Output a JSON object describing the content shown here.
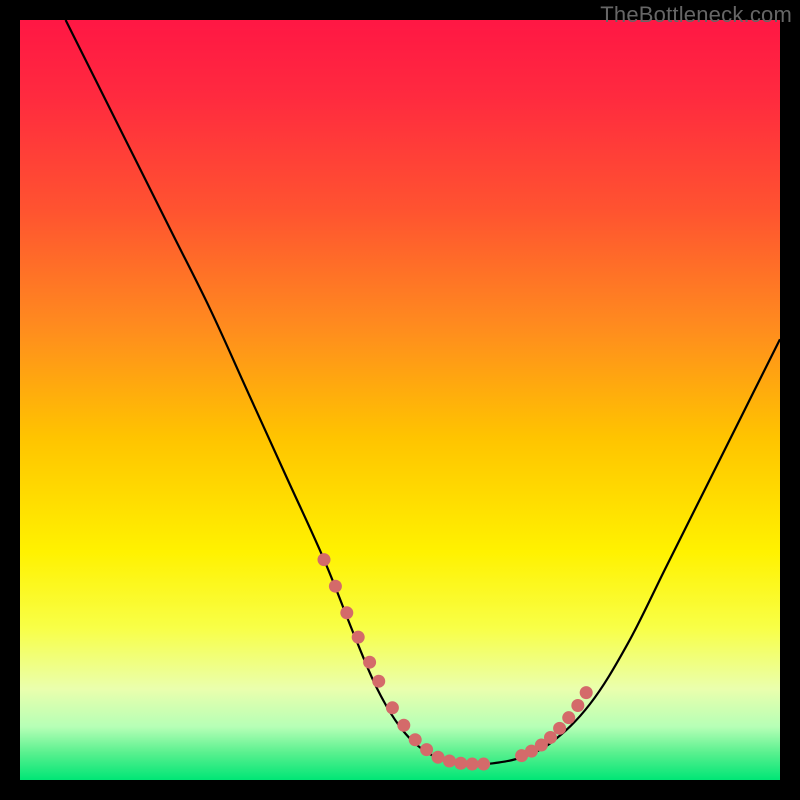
{
  "watermark": "TheBottleneck.com",
  "colors": {
    "gradient_stops": [
      {
        "offset": 0,
        "color": "#ff1744"
      },
      {
        "offset": 0.1,
        "color": "#ff2a3f"
      },
      {
        "offset": 0.25,
        "color": "#ff5330"
      },
      {
        "offset": 0.4,
        "color": "#ff8a1f"
      },
      {
        "offset": 0.55,
        "color": "#ffc400"
      },
      {
        "offset": 0.7,
        "color": "#fff200"
      },
      {
        "offset": 0.8,
        "color": "#f8ff47"
      },
      {
        "offset": 0.88,
        "color": "#eaffad"
      },
      {
        "offset": 0.93,
        "color": "#b6ffb6"
      },
      {
        "offset": 0.965,
        "color": "#57f08e"
      },
      {
        "offset": 1.0,
        "color": "#00e676"
      }
    ],
    "curve": "#000000",
    "dots": "#d46a6a"
  },
  "chart_data": {
    "type": "line",
    "title": "",
    "xlabel": "",
    "ylabel": "",
    "xlim": [
      0,
      100
    ],
    "ylim": [
      0,
      100
    ],
    "grid": false,
    "legend": false,
    "series": [
      {
        "name": "bottleneck-curve",
        "x": [
          6,
          10,
          15,
          20,
          25,
          30,
          35,
          40,
          44,
          47,
          50,
          53,
          56,
          58,
          60,
          63,
          66,
          70,
          75,
          80,
          85,
          90,
          95,
          100
        ],
        "y": [
          100,
          92,
          82,
          72,
          62,
          51,
          40,
          29,
          19,
          12,
          7,
          4,
          2.5,
          2,
          2,
          2.3,
          3,
          5,
          10,
          18,
          28,
          38,
          48,
          58
        ]
      }
    ],
    "markers": {
      "name": "highlight-dots",
      "x": [
        40,
        41.5,
        43,
        44.5,
        46,
        47.2,
        49,
        50.5,
        52,
        53.5,
        55,
        56.5,
        58,
        59.5,
        61,
        66,
        67.3,
        68.6,
        69.8,
        71,
        72.2,
        73.4,
        74.5
      ],
      "y": [
        29,
        25.5,
        22,
        18.8,
        15.5,
        13,
        9.5,
        7.2,
        5.3,
        4,
        3,
        2.5,
        2.2,
        2.1,
        2.1,
        3.2,
        3.8,
        4.6,
        5.6,
        6.8,
        8.2,
        9.8,
        11.5
      ]
    }
  }
}
